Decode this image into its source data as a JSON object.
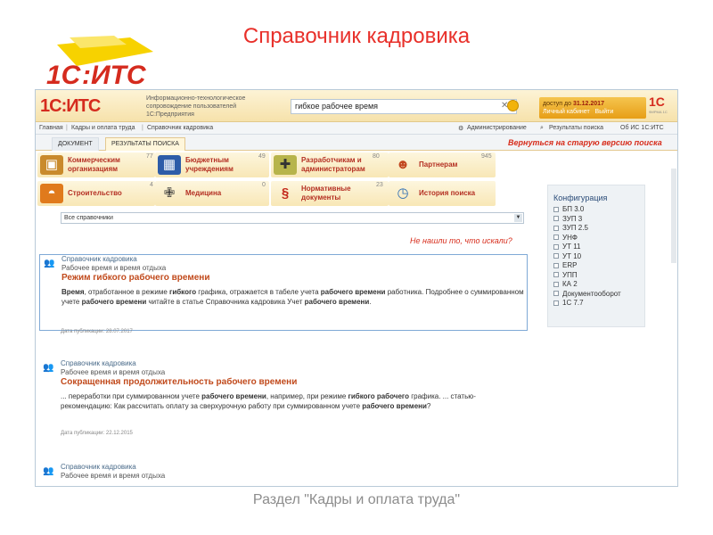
{
  "slide": {
    "title": "Справочник кадровика",
    "footer": "Раздел \"Кадры и оплата труда\"",
    "logo_text": "1С:ИТС"
  },
  "header": {
    "logo": "1С:ИТС",
    "description": [
      "Информационно-технологическое",
      "сопровождение пользователей",
      "1С:Предприятия"
    ],
    "search_value": "гибкое рабочее время",
    "access_label": "доступ до",
    "access_date": "31.12.2017",
    "cabinet_link": "Личный кабинет",
    "logout_link": "Выйти",
    "right_logo": "1С",
    "right_logo_sub": "ФИРМА 1С"
  },
  "breadcrumb": [
    "Главная",
    "Кадры и оплата труда",
    "Справочник кадровика"
  ],
  "nav_right": [
    "Администрирование",
    "Результаты поиска",
    "Об ИС 1С:ИТС"
  ],
  "tabs": [
    "ДОКУМЕНТ",
    "РЕЗУЛЬТАТЫ ПОИСКА"
  ],
  "old_version_link": "Вернуться на старую версию поиска",
  "categories": [
    {
      "label": [
        "Коммерческим",
        "организациям"
      ],
      "count": "77",
      "icon": "briefcase-icon"
    },
    {
      "label": [
        "Бюджетным",
        "учреждениям"
      ],
      "count": "49",
      "icon": "building-icon"
    },
    {
      "label": [
        "Разработчикам и",
        "администраторам"
      ],
      "count": "80",
      "icon": "tools-icon"
    },
    {
      "label": [
        "Партнерам"
      ],
      "count": "945",
      "icon": "people-icon"
    },
    {
      "label": [
        "Строительство"
      ],
      "count": "4",
      "icon": "helmet-icon"
    },
    {
      "label": [
        "Медицина"
      ],
      "count": "0",
      "icon": "medical-cross-icon"
    },
    {
      "label": [
        "Нормативные",
        "документы"
      ],
      "count": "23",
      "icon": "section-sign-icon"
    },
    {
      "label": [
        "История поиска"
      ],
      "count": "",
      "icon": "clock-icon"
    }
  ],
  "filter_select": "Все справочники",
  "not_found_link": "Не нашли то, что искали?",
  "results": [
    {
      "source": "Справочник кадровика",
      "section": "Рабочее время и время отдыха",
      "title": "Режим гибкого рабочего времени",
      "text": [
        {
          "t": "Время",
          "b": true
        },
        {
          "t": ", отработанное в режиме ",
          "b": false
        },
        {
          "t": "гибкого",
          "b": true
        },
        {
          "t": " графика, отражается в табеле учета ",
          "b": false
        },
        {
          "t": "рабочего времени",
          "b": true
        },
        {
          "t": " работника. Подробнее о суммированном учете ",
          "b": false
        },
        {
          "t": "рабочего времени",
          "b": true
        },
        {
          "t": " читайте в статье Справочника кадровика Учет ",
          "b": false
        },
        {
          "t": "рабочего времени",
          "b": true
        },
        {
          "t": ".",
          "b": false
        }
      ],
      "date": "Дата публикации: 28.07.2017"
    },
    {
      "source": "Справочник кадровика",
      "section": "Рабочее время и время отдыха",
      "title": "Сокращенная продолжительность рабочего времени",
      "text": [
        {
          "t": "... переработки при суммированном учете ",
          "b": false
        },
        {
          "t": "рабочего времени",
          "b": true
        },
        {
          "t": ", например, при режиме ",
          "b": false
        },
        {
          "t": "гибкого рабочего",
          "b": true
        },
        {
          "t": " графика. ... статью-рекомендацию: Как рассчитать оплату за сверхурочную работу при суммированном учете ",
          "b": false
        },
        {
          "t": "рабочего времени",
          "b": true
        },
        {
          "t": "?",
          "b": false
        }
      ],
      "date": "Дата публикации: 22.12.2015"
    },
    {
      "source": "Справочник кадровика",
      "section": "Рабочее время и время отдыха",
      "title": "",
      "text": [],
      "date": ""
    }
  ],
  "config": {
    "title": "Конфигурация",
    "items": [
      "БП 3.0",
      "ЗУП 3",
      "ЗУП 2.5",
      "УНФ",
      "УТ 11",
      "УТ 10",
      "ERP",
      "УПП",
      "КА 2",
      "Документооборот",
      "1С 7.7"
    ]
  }
}
